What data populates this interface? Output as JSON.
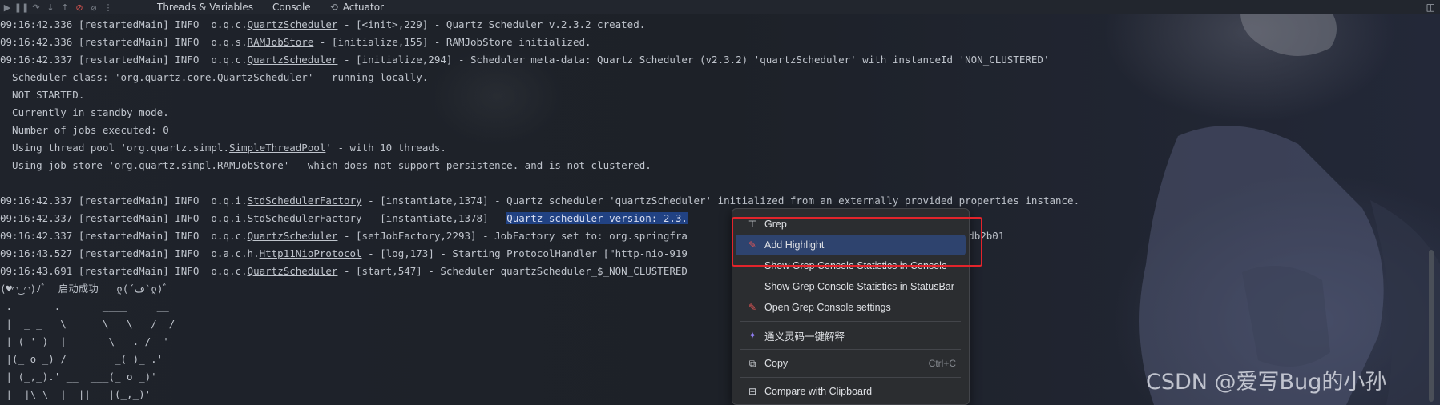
{
  "toolbar": {
    "icons": [
      "resume-icon",
      "pause-icon",
      "step-over-icon",
      "step-into-icon",
      "step-out-icon",
      "mute-breakpoints-icon",
      "clear-icon",
      "more-icon"
    ],
    "tabs": [
      {
        "label": "Threads & Variables"
      },
      {
        "label": "Console"
      },
      {
        "label": "Actuator",
        "icon": "actuator-icon"
      }
    ],
    "right_icon": "layout-icon"
  },
  "console": {
    "lines": [
      {
        "pre": "09:16:42.336 [restartedMain] INFO  o.q.c.",
        "link": "QuartzScheduler",
        "post": " - [<init>,229] - Quartz Scheduler v.2.3.2 created."
      },
      {
        "pre": "09:16:42.336 [restartedMain] INFO  o.q.s.",
        "link": "RAMJobStore",
        "post": " - [initialize,155] - RAMJobStore initialized."
      },
      {
        "pre": "09:16:42.337 [restartedMain] INFO  o.q.c.",
        "link": "QuartzScheduler",
        "post": " - [initialize,294] - Scheduler meta-data: Quartz Scheduler (v2.3.2) 'quartzScheduler' with instanceId 'NON_CLUSTERED'"
      },
      {
        "pre": "  Scheduler class: 'org.quartz.core.",
        "link": "QuartzScheduler",
        "post": "' - running locally."
      },
      {
        "pre": "  NOT STARTED.",
        "link": "",
        "post": ""
      },
      {
        "pre": "  Currently in standby mode.",
        "link": "",
        "post": ""
      },
      {
        "pre": "  Number of jobs executed: 0",
        "link": "",
        "post": ""
      },
      {
        "pre": "  Using thread pool 'org.quartz.simpl.",
        "link": "SimpleThreadPool",
        "post": "' - with 10 threads."
      },
      {
        "pre": "  Using job-store 'org.quartz.simpl.",
        "link": "RAMJobStore",
        "post": "' - which does not support persistence. and is not clustered."
      },
      {
        "pre": "",
        "link": "",
        "post": ""
      },
      {
        "pre": "09:16:42.337 [restartedMain] INFO  o.q.i.",
        "link": "StdSchedulerFactory",
        "post": " - [instantiate,1374] - Quartz scheduler 'quartzScheduler' initialized from an externally provided properties instance."
      },
      {
        "pre": "09:16:42.337 [restartedMain] INFO  o.q.i.",
        "link": "StdSchedulerFactory",
        "post": " - [instantiate,1378] - ",
        "selected": "Quartz scheduler version: 2.3.",
        "tail": ""
      },
      {
        "pre": "09:16:42.337 [restartedMain] INFO  o.q.c.",
        "link": "QuartzScheduler",
        "post": " - [setJobFactory,2293] - JobFactory set to: org.springfra",
        "gap": 275,
        "tail": "Factory@54db2b01"
      },
      {
        "pre": "09:16:43.527 [restartedMain] INFO  o.a.c.h.",
        "link": "Http11NioProtocol",
        "post": " - [log,173] - Starting ProtocolHandler [\"http-nio-919"
      },
      {
        "pre": "09:16:43.691 [restartedMain] INFO  o.q.c.",
        "link": "QuartzScheduler",
        "post": " - [start,547] - Scheduler quartzScheduler_$_NON_CLUSTERED"
      },
      {
        "pre": "(♥◠‿◠)ﾉﾞ  启动成功   ლ(´ڡ`ლ)ﾞ",
        "link": "",
        "post": ""
      },
      {
        "pre": " .-------.       ____     __",
        "link": "",
        "post": ""
      },
      {
        "pre": " |  _ _   \\      \\   \\   /  /",
        "link": "",
        "post": ""
      },
      {
        "pre": " | ( ' )  |       \\  _. /  '",
        "link": "",
        "post": ""
      },
      {
        "pre": " |(_ o _) /        _( )_ .'",
        "link": "",
        "post": ""
      },
      {
        "pre": " | (_,_).' __  ___(_ o _)'",
        "link": "",
        "post": ""
      },
      {
        "pre": " |  |\\ \\  |  ||   |(_,_)'",
        "link": "",
        "post": ""
      }
    ]
  },
  "context_menu": {
    "items": [
      {
        "label": "Grep",
        "icon": "grep-icon",
        "glyph": "⊤"
      },
      {
        "label": "Add Highlight",
        "icon": "highlight-icon",
        "glyph": "✎",
        "active": true
      },
      {
        "label": "Show Grep Console Statistics in Console",
        "icon": "",
        "glyph": ""
      },
      {
        "label": "Show Grep Console Statistics in StatusBar",
        "icon": "",
        "glyph": ""
      },
      {
        "label": "Open Grep Console settings",
        "icon": "settings-pencil-icon",
        "glyph": "✎",
        "sep_after": true
      },
      {
        "label": "通义灵码一键解释",
        "icon": "tongyi-lingma-icon",
        "glyph": "✦",
        "sep_after": true
      },
      {
        "label": "Copy",
        "icon": "copy-icon",
        "glyph": "⧉",
        "shortcut": "Ctrl+C",
        "sep_after": true
      },
      {
        "label": "Compare with Clipboard",
        "icon": "compare-icon",
        "glyph": "⊟"
      }
    ]
  },
  "watermark": "CSDN @爱写Bug的小孙",
  "colors": {
    "highlight_box": "#e3242b",
    "selection": "#214283",
    "menu_active": "#2e436e"
  }
}
